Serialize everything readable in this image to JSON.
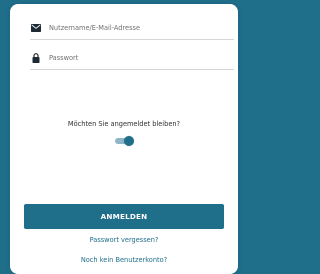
{
  "colors": {
    "background": "#1f6f8b",
    "card": "#ffffff",
    "accent": "#1f6f8b",
    "link": "#1f6f8b"
  },
  "login_form": {
    "username": {
      "icon": "envelope-icon",
      "value": "",
      "placeholder": "Nutzername/E-Mail-Adresse"
    },
    "password": {
      "icon": "lock-icon",
      "value": "",
      "placeholder": "Passwort"
    },
    "remember_me": {
      "label": "Möchten Sie angemeldet bleiben?",
      "enabled": true
    },
    "login_button_label": "ANMELDEN",
    "forgot_password_link": "Passwort vergessen?",
    "no_account_link": "Noch kein Benutzerkonto?"
  }
}
